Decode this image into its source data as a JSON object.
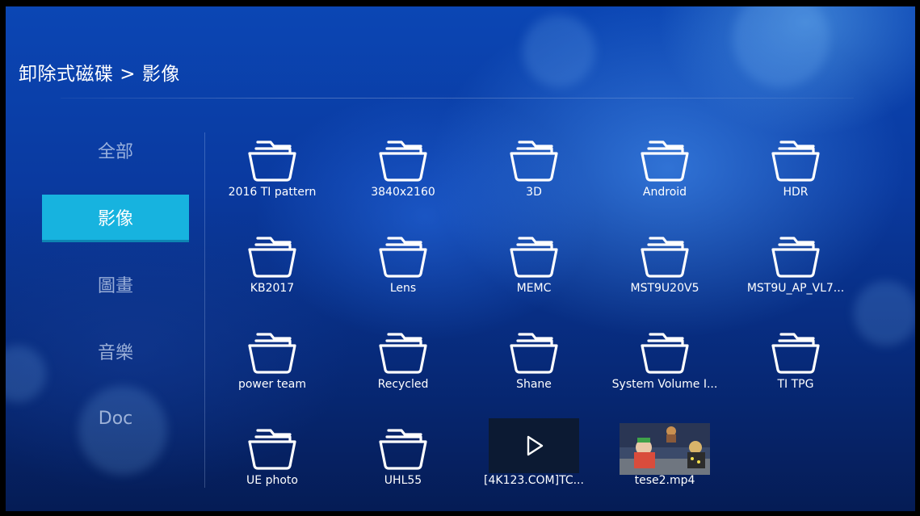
{
  "breadcrumb": "卸除式磁碟 > 影像",
  "sidebar": {
    "items": [
      {
        "label": "全部"
      },
      {
        "label": "影像"
      },
      {
        "label": "圖畫"
      },
      {
        "label": "音樂"
      },
      {
        "label": "Doc"
      }
    ],
    "active_index": 1
  },
  "files": [
    {
      "name": "2016 TI pattern",
      "type": "folder",
      "icon": "folder-icon"
    },
    {
      "name": "3840x2160",
      "type": "folder",
      "icon": "folder-icon"
    },
    {
      "name": "3D",
      "type": "folder",
      "icon": "folder-icon"
    },
    {
      "name": "Android",
      "type": "folder",
      "icon": "folder-icon"
    },
    {
      "name": "HDR",
      "type": "folder",
      "icon": "folder-icon"
    },
    {
      "name": "KB2017",
      "type": "folder",
      "icon": "folder-icon"
    },
    {
      "name": "Lens",
      "type": "folder",
      "icon": "folder-icon"
    },
    {
      "name": "MEMC",
      "type": "folder",
      "icon": "folder-icon"
    },
    {
      "name": "MST9U20V5",
      "type": "folder",
      "icon": "folder-icon"
    },
    {
      "name": "MST9U_AP_VL7...",
      "type": "folder",
      "icon": "folder-icon"
    },
    {
      "name": "power team",
      "type": "folder",
      "icon": "folder-icon"
    },
    {
      "name": "Recycled",
      "type": "folder",
      "icon": "folder-icon"
    },
    {
      "name": "Shane",
      "type": "folder",
      "icon": "folder-icon"
    },
    {
      "name": "System Volume I...",
      "type": "folder",
      "icon": "folder-icon"
    },
    {
      "name": "TI TPG",
      "type": "folder",
      "icon": "folder-icon"
    },
    {
      "name": "UE photo",
      "type": "folder",
      "icon": "folder-icon"
    },
    {
      "name": "UHL55",
      "type": "folder",
      "icon": "folder-icon"
    },
    {
      "name": "[4K123.COM]TC...",
      "type": "video",
      "icon": "play-icon"
    },
    {
      "name": "tese2.mp4",
      "type": "image",
      "icon": "photo-thumbnail"
    }
  ],
  "colors": {
    "accent": "#17b3df",
    "text": "#ffffff",
    "inactive_text": "#c8d7f0"
  }
}
